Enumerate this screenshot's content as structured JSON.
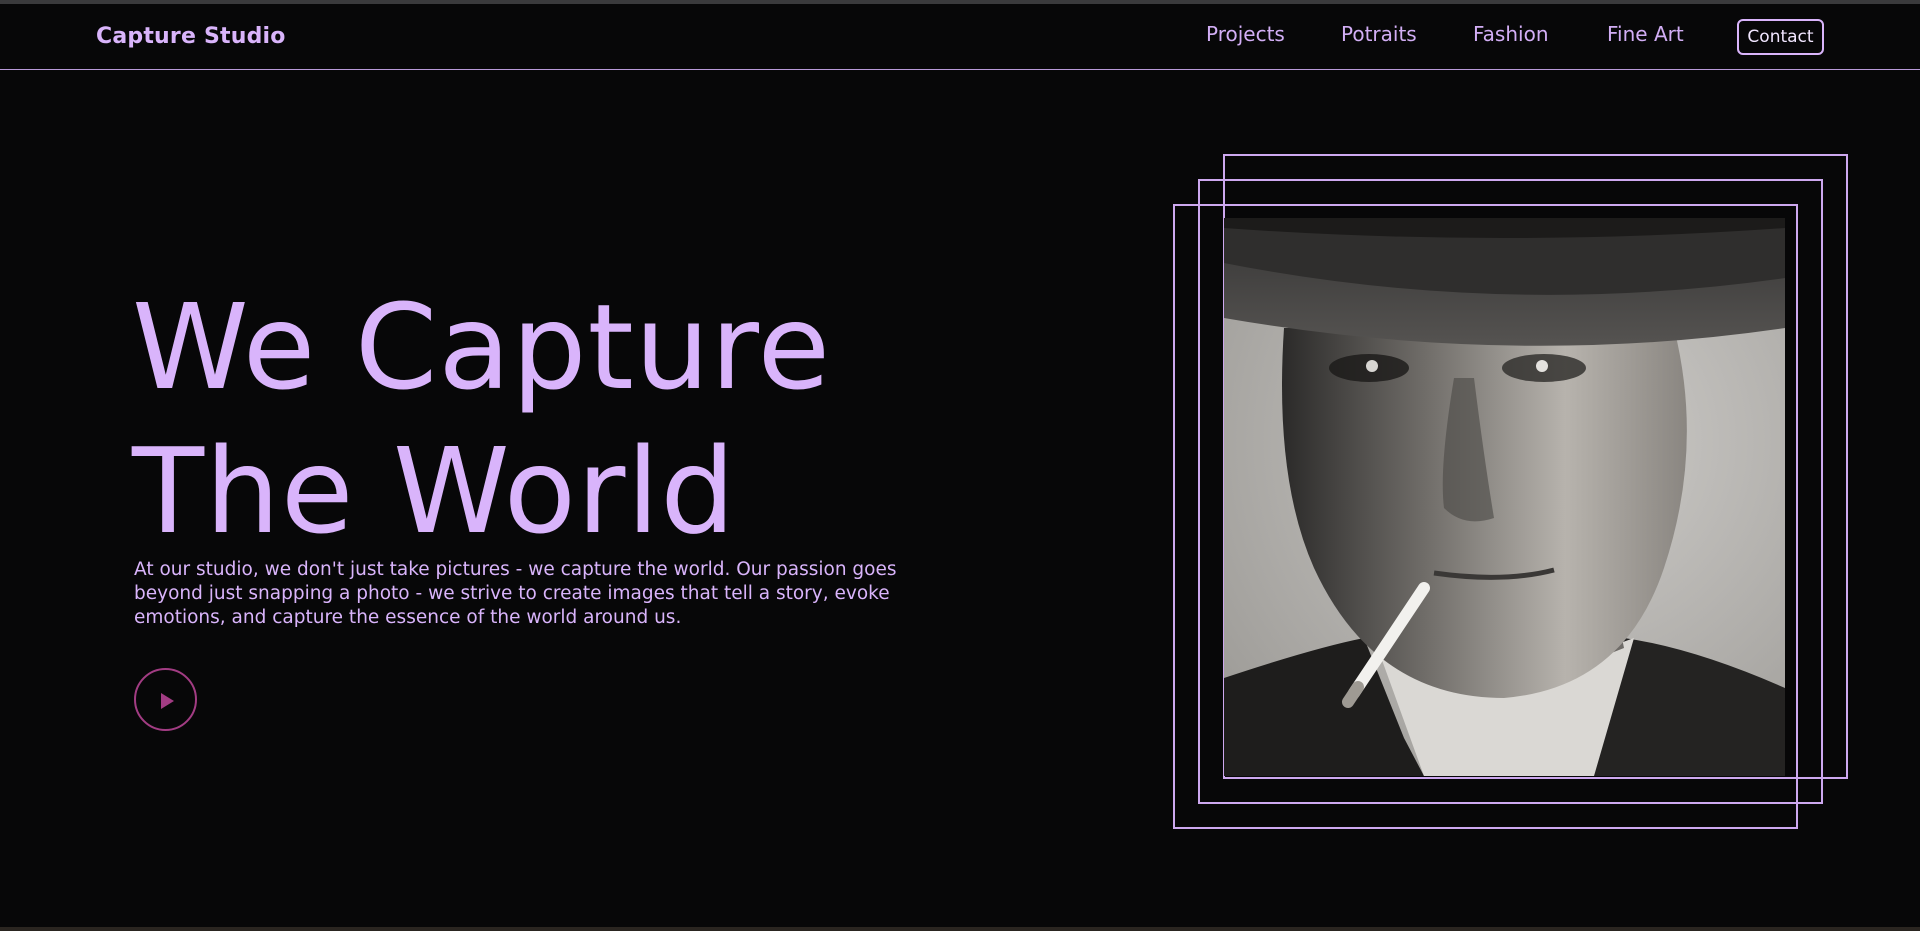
{
  "nav": {
    "brand": "Capture Studio",
    "links": [
      "Projects",
      "Potraits",
      "Fashion",
      "Fine Art"
    ],
    "contact_label": "Contact"
  },
  "hero": {
    "title_line1": "We Capture",
    "title_line2": "The World",
    "description": "At our studio, we don't just take pictures - we capture the world. Our passion goes beyond just snapping a photo - we strive to create images that tell a story, evoke emotions, and capture the essence of the world around us.",
    "play_icon": "play-icon",
    "image_icon": "portrait-photo"
  },
  "colors": {
    "accent": "#d9b4fb",
    "frame": "#cda8ef",
    "play": "#a23c83",
    "background": "#070708"
  }
}
